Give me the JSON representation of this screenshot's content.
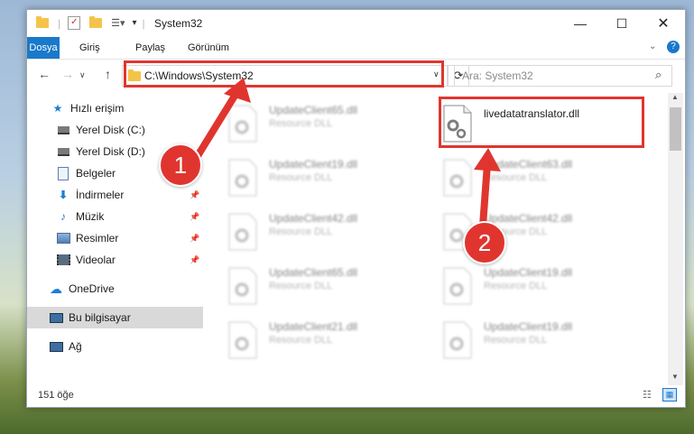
{
  "window": {
    "title": "System32"
  },
  "ribbon": {
    "tabs": [
      "Dosya",
      "Giriş",
      "Paylaş",
      "Görünüm"
    ]
  },
  "navigation": {
    "address": "C:\\Windows\\System32",
    "search_placeholder": "Ara: System32"
  },
  "sidebar": {
    "items": [
      {
        "label": "Hızlı erişim",
        "icon": "star-icon"
      },
      {
        "label": "Yerel Disk (C:)",
        "icon": "drive-icon"
      },
      {
        "label": "Yerel Disk (D:)",
        "icon": "drive-icon"
      },
      {
        "label": "Belgeler",
        "icon": "documents-icon"
      },
      {
        "label": "İndirmeler",
        "icon": "download-icon"
      },
      {
        "label": "Müzik",
        "icon": "music-icon"
      },
      {
        "label": "Resimler",
        "icon": "pictures-icon"
      },
      {
        "label": "Videolar",
        "icon": "videos-icon"
      },
      {
        "label": "OneDrive",
        "icon": "cloud-icon"
      },
      {
        "label": "Bu bilgisayar",
        "icon": "computer-icon"
      },
      {
        "label": "Ağ",
        "icon": "network-icon"
      }
    ]
  },
  "files": [
    {
      "name": "UpdateClient65.dll",
      "type": "Resource DLL"
    },
    {
      "name": "livedatatranslator.dll",
      "type": ""
    },
    {
      "name": "UpdateClient19.dll",
      "type": "Resource DLL"
    },
    {
      "name": "UpdateClient63.dll",
      "type": "Resource DLL"
    },
    {
      "name": "UpdateClient42.dll",
      "type": "Resource DLL"
    },
    {
      "name": "UpdateClient42.dll",
      "type": "Resource DLL"
    },
    {
      "name": "UpdateClient65.dll",
      "type": "Resource DLL"
    },
    {
      "name": "UpdateClient19.dll",
      "type": "Resource DLL"
    },
    {
      "name": "UpdateClient21.dll",
      "type": "Resource DLL"
    },
    {
      "name": "UpdateClient19.dll",
      "type": "Resource DLL"
    }
  ],
  "status": {
    "item_count": "151 öğe"
  },
  "annotations": {
    "step1": "1",
    "step2": "2",
    "color": "#e0352f"
  }
}
